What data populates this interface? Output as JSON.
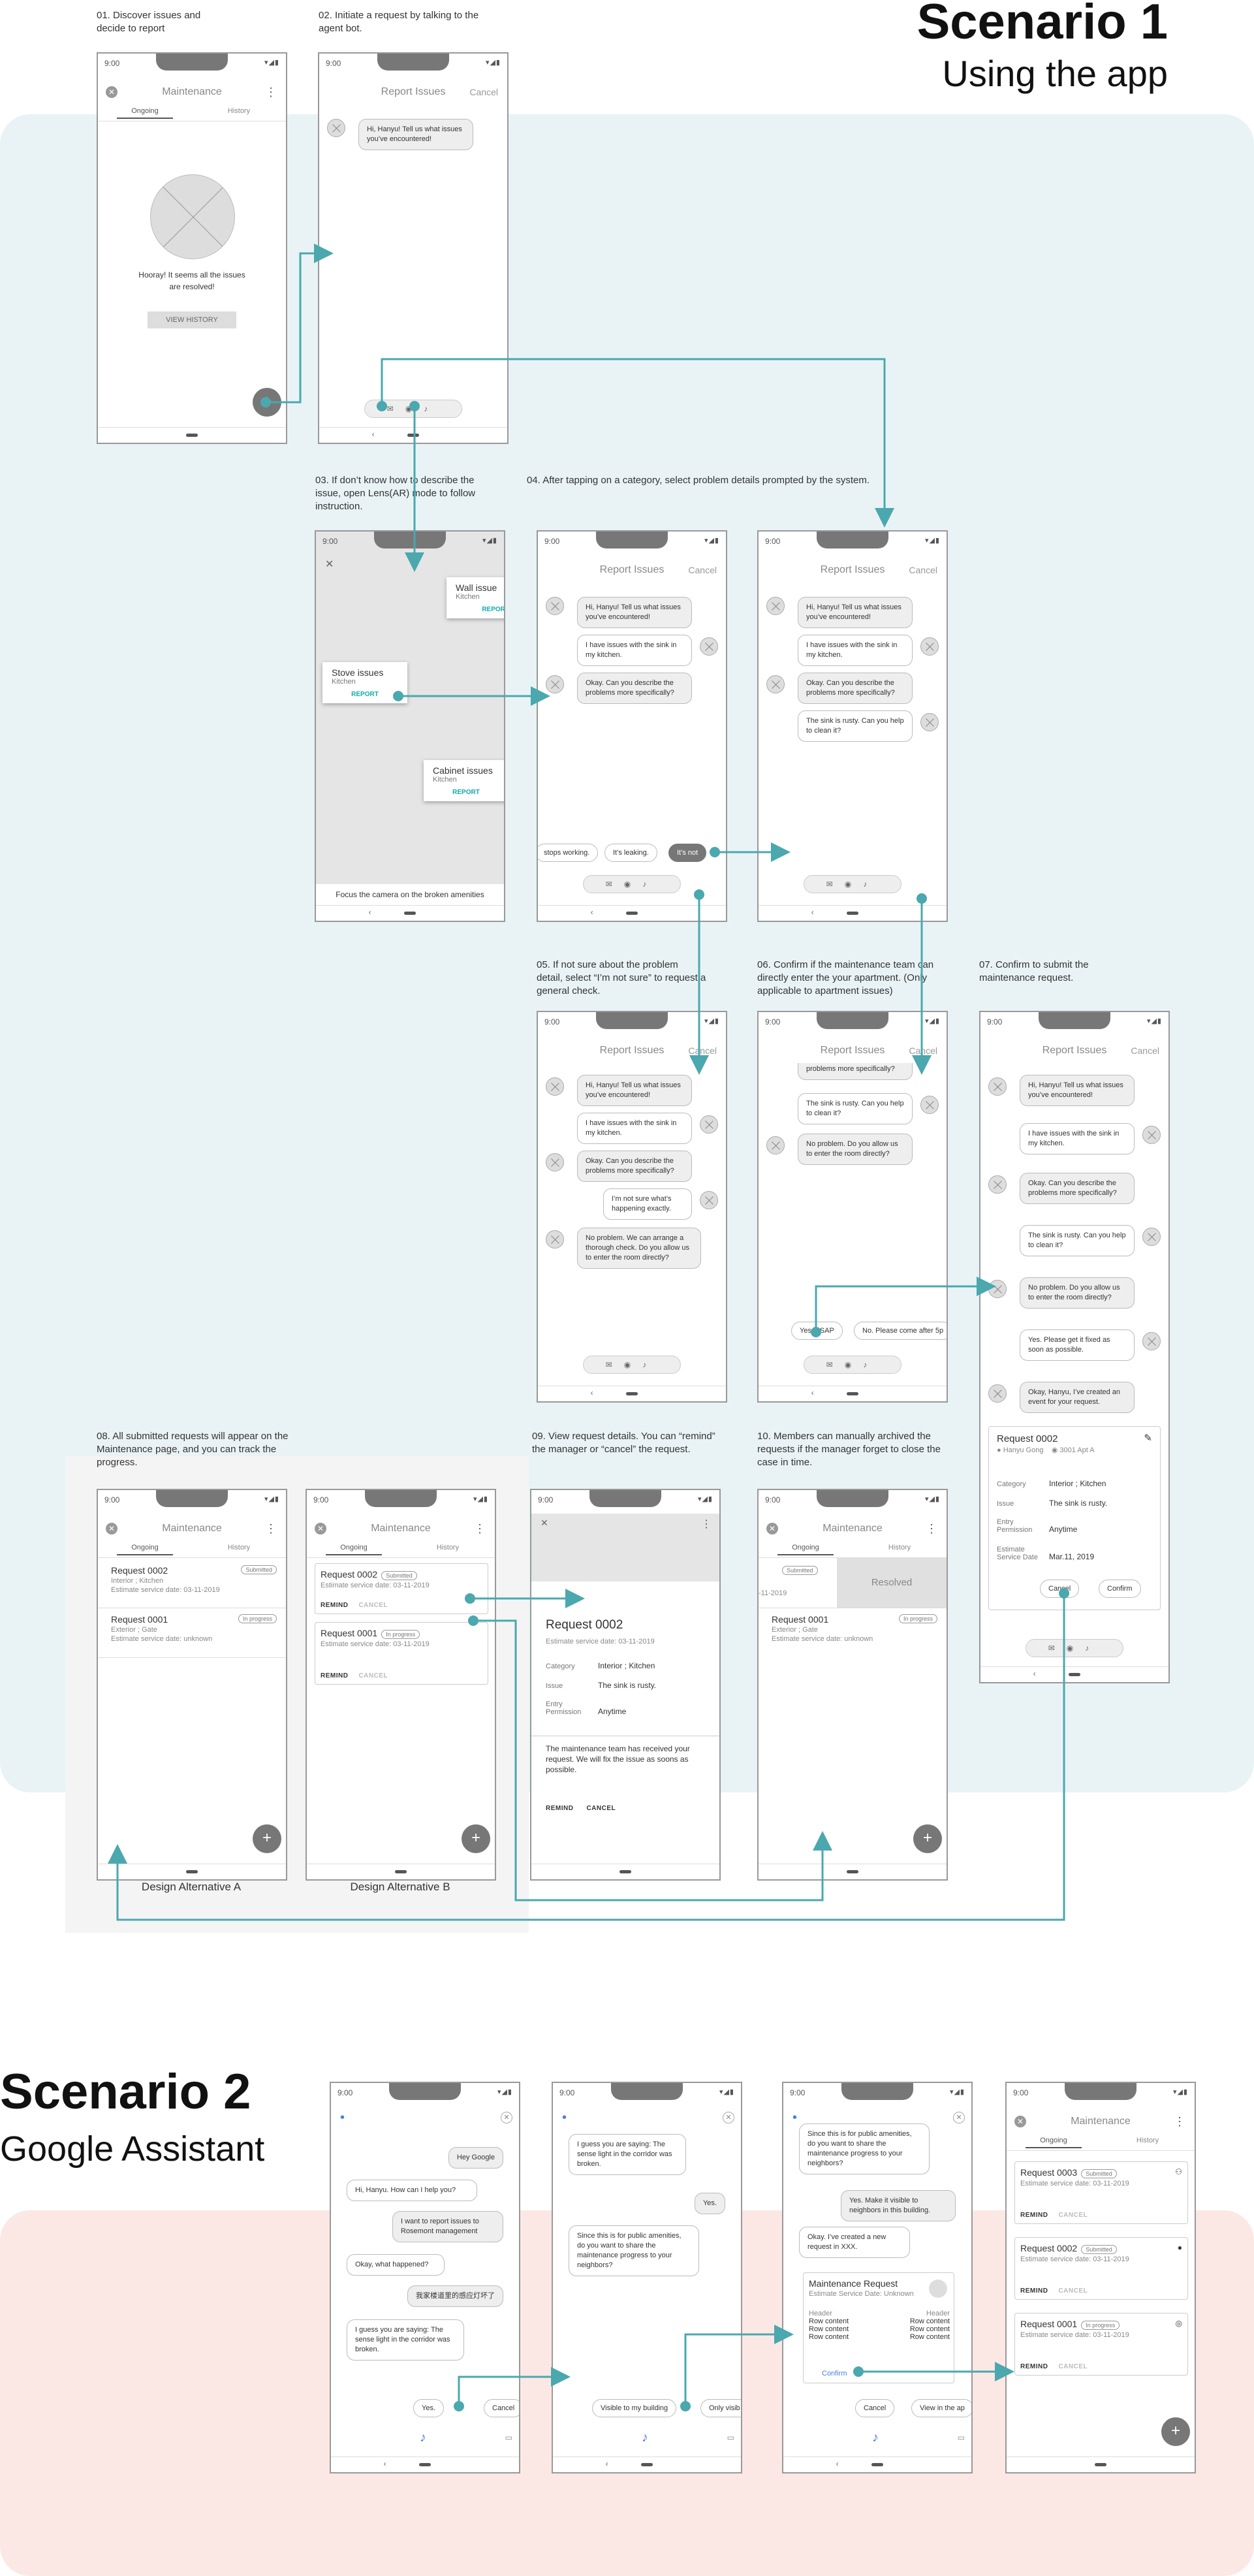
{
  "scenario1": {
    "title": "Scenario 1",
    "subtitle": "Using the app"
  },
  "scenario2": {
    "title": "Scenario 2",
    "subtitle": "Google Assistant"
  },
  "captions": {
    "c01": "01. Discover issues and decide to report",
    "c02": "02. Initiate a request by talking to the agent bot.",
    "c03": "03. If don’t know how to describe the issue, open Lens(AR) mode to follow instruction.",
    "c04": "04. After tapping on a category, select problem details prompted by the system.",
    "c05": "05. If not sure about the problem detail, select “I’m not sure” to request a general check.",
    "c06": "06. Confirm if the maintenance team can directly enter the your apartment. (Only applicable to apartment issues)",
    "c07": "07. Confirm to submit the maintenance request.",
    "c08": "08. All submitted requests will appear on the Maintenance page, and you can track the progress.",
    "c09": "09. View request details. You can “remind” the manager or “cancel” the request.",
    "c10": "10. Members can manually archived the requests if the manager forget to close the case in time.",
    "altA": "Design Alternative A",
    "altB": "Design Alternative B"
  },
  "status": {
    "time": "9:00",
    "icons": "▾◢▮"
  },
  "ui": {
    "maintenance": "Maintenance",
    "ongoing": "Ongoing",
    "history": "History",
    "report_issues": "Report Issues",
    "cancel": "Cancel",
    "hooray": "Hooray! It seems all the issues are resolved!",
    "view_history": "VIEW HISTORY",
    "plus": "+",
    "close": "✕",
    "dots": "⋮",
    "input_icons": "✉◉♪"
  },
  "chat": {
    "greet": "Hi, Hanyu! Tell us what issues you’ve encountered!",
    "sink": "I have issues with the sink in my kitchen.",
    "describe": "Okay. Can you describe the problems more specifically?",
    "rusty": "The sink is rusty. Can you help to clean it?",
    "notsure": "I’m not sure what’s happening exactly.",
    "arrange": "No problem. We can arrange a thorough check. Do you allow us to enter the room directly?",
    "allow": "No problem. Do you allow us to enter the room directly?",
    "yes_fix": "Yes. Please get it fixed as soon as possible.",
    "created": "Okay, Hanyu, I’ve created an event for your request.",
    "chip_stops": "stops working.",
    "chip_leaking": "It’s leaking.",
    "chip_notsure": "It’s not",
    "chip_yesasap": "Yes, ASAP",
    "chip_nocome": "No. Please come after 5p"
  },
  "ar": {
    "wall": "Wall issue",
    "wall_loc": "Kitchen",
    "stove": "Stove issues",
    "stove_loc": "Kitchen",
    "cabinet": "Cabinet issues",
    "cabinet_loc": "Kitchen",
    "report": "REPORT",
    "focus": "Focus the camera on the broken amenities"
  },
  "confirm": {
    "title": "Request 0002",
    "user": "Hanyu Gong",
    "apt": "3001 Apt A",
    "cat_k": "Category",
    "cat_v": "Interior ; Kitchen",
    "issue_k": "Issue",
    "issue_v": "The sink is rusty.",
    "entry_k": "Entry Permission",
    "entry_v": "Anytime",
    "date_k": "Estimate Service Date",
    "date_v": "Mar.11, 2019",
    "cancel": "Cancel",
    "confirm": "Confirm"
  },
  "requests": {
    "r2": "Request 0002",
    "r2_loc": "Interior ; Kitchen",
    "r2_date": "Estimate service date: 03-11-2019",
    "submitted": "Submitted",
    "r1": "Request 0001",
    "r1_loc": "Exterior ; Gate",
    "r1_date": "Estimate service date: unknown",
    "r1_date_b": "Estimate service date: 03-11-2019",
    "inprogress": "In progress",
    "r3": "Request 0003",
    "remind": "REMIND",
    "cancel": "CANCEL",
    "resolved": "Resolved",
    "partial_date": "-11-2019"
  },
  "detail": {
    "title": "Request 0002",
    "date": "Estimate service date: 03-11-2019",
    "cat_k": "Category",
    "cat_v": "Interior ; Kitchen",
    "issue_k": "Issue",
    "issue_v": "The sink is rusty.",
    "entry_k": "Entry Permission",
    "entry_v": "Anytime",
    "note": "The maintenance team has received your request. We will fix the issue as soons as possible.",
    "remind": "REMIND",
    "cancel": "CANCEL"
  },
  "assistant": {
    "hey": "Hey Google",
    "help": "Hi, Hanyu. How can I help you?",
    "report": "I want to report issues to Rosemont management",
    "what": "Okay, what happened?",
    "zh": "我家楼道里的感应灯坏了",
    "saying": "I guess you are saying: The sense light in the corridor was broken.",
    "yes": "Yes.",
    "cancel": "Cancel",
    "public": "Since this is for public amenities, do you want to share the maintenance progress to your neighbors?",
    "visible": "Visible to my building",
    "only": "Only visib",
    "make_visible": "Yes. Make it visible to neighbors in this building.",
    "created": "Okay. I’ve created a new request in XXX.",
    "mr_title": "Maintenance Request",
    "mr_date": "Estimate Service Date: Unknown",
    "header": "Header",
    "row": "Row content",
    "confirm": "Confirm",
    "view": "View in the ap"
  }
}
